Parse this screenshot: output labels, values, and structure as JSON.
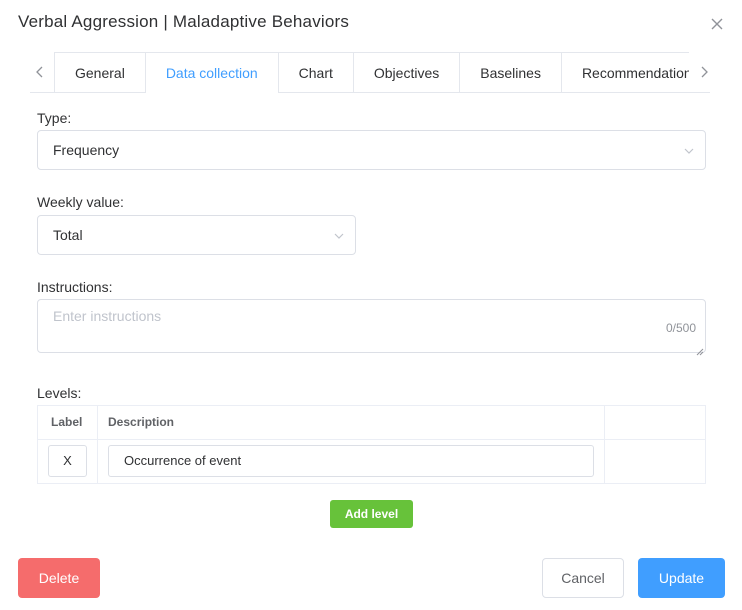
{
  "dialog": {
    "title": "Verbal Aggression | Maladaptive Behaviors",
    "close_icon": "close-icon"
  },
  "tabs": [
    {
      "label": "General",
      "active": false
    },
    {
      "label": "Data collection",
      "active": true
    },
    {
      "label": "Chart",
      "active": false
    },
    {
      "label": "Objectives",
      "active": false
    },
    {
      "label": "Baselines",
      "active": false
    },
    {
      "label": "Recommendations",
      "active": false
    }
  ],
  "form": {
    "type": {
      "label": "Type:",
      "value": "Frequency"
    },
    "weekly_value": {
      "label": "Weekly value:",
      "value": "Total"
    },
    "instructions": {
      "label": "Instructions:",
      "placeholder": "Enter instructions",
      "count": "0/500"
    },
    "levels": {
      "label": "Levels:",
      "columns": [
        "Label",
        "Description"
      ],
      "rows": [
        {
          "label": "X",
          "description": "Occurrence of event"
        }
      ],
      "add_label": "Add level"
    }
  },
  "footer": {
    "delete_label": "Delete",
    "cancel_label": "Cancel",
    "update_label": "Update"
  },
  "colors": {
    "primary": "#409eff",
    "success": "#67c23a",
    "danger": "#f56c6c"
  }
}
